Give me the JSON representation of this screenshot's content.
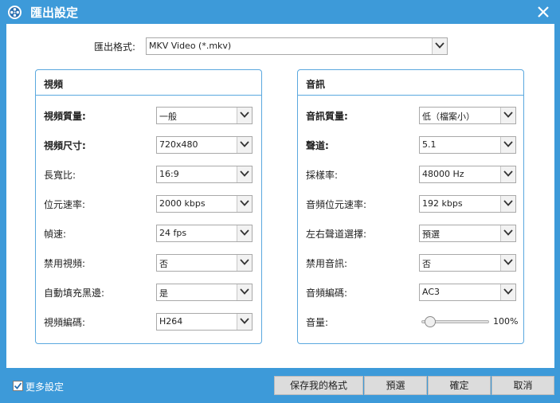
{
  "window": {
    "title": "匯出設定"
  },
  "format": {
    "label": "匯出格式:",
    "value": "MKV Video (*.mkv)"
  },
  "video": {
    "heading": "視頻",
    "rows": [
      {
        "label": "視頻質量:",
        "value": "一般"
      },
      {
        "label": "視頻尺寸:",
        "value": "720x480"
      },
      {
        "label": "長寬比:",
        "value": "16:9"
      },
      {
        "label": "位元速率:",
        "value": "2000 kbps"
      },
      {
        "label": "幀速:",
        "value": "24 fps"
      },
      {
        "label": "禁用視頻:",
        "value": "否"
      },
      {
        "label": "自動填充黑邊:",
        "value": "是"
      },
      {
        "label": "視頻編碼:",
        "value": "H264"
      }
    ]
  },
  "audio": {
    "heading": "音訊",
    "rows": [
      {
        "label": "音訊質量:",
        "value": "低（檔案小）"
      },
      {
        "label": "聲道:",
        "value": "5.1"
      },
      {
        "label": "採樣率:",
        "value": "48000 Hz"
      },
      {
        "label": "音頻位元速率:",
        "value": "192 kbps"
      },
      {
        "label": "左右聲道選擇:",
        "value": "預選"
      },
      {
        "label": "禁用音訊:",
        "value": "否"
      },
      {
        "label": "音頻編碼:",
        "value": "AC3"
      }
    ],
    "volume": {
      "label": "音量:",
      "value": 100,
      "display": "100%"
    }
  },
  "footer": {
    "more_settings": {
      "label": "更多設定",
      "checked": true
    },
    "save_format": "保存我的格式",
    "default": "預選",
    "ok": "確定",
    "cancel": "取消"
  },
  "colors": {
    "frame": "#3d9ad9",
    "panel_border": "#5aa8df"
  }
}
